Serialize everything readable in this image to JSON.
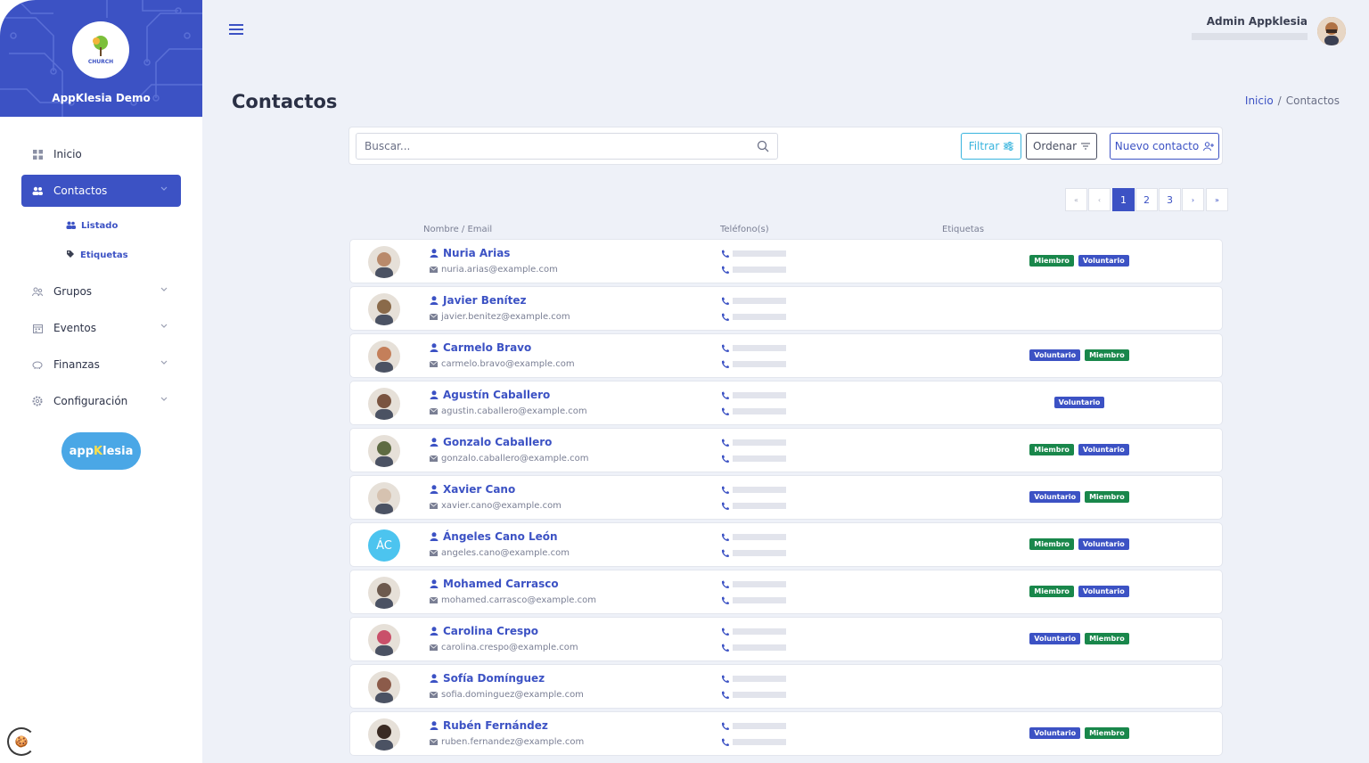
{
  "app": {
    "name": "AppKlesia Demo",
    "logo_text": "CHURCH"
  },
  "sidebar": {
    "items": [
      {
        "label": "Inicio",
        "icon": "grid-icon"
      },
      {
        "label": "Contactos",
        "icon": "users-icon",
        "active": true,
        "children": [
          {
            "label": "Listado",
            "icon": "users-icon"
          },
          {
            "label": "Etiquetas",
            "icon": "tag-icon"
          }
        ]
      },
      {
        "label": "Grupos",
        "icon": "group-icon"
      },
      {
        "label": "Eventos",
        "icon": "calendar-icon"
      },
      {
        "label": "Finanzas",
        "icon": "piggy-bank-icon"
      },
      {
        "label": "Configuración",
        "icon": "gear-icon"
      }
    ],
    "brand": {
      "prefix": "app",
      "k": "K",
      "suffix": "lesia"
    }
  },
  "header": {
    "user_name": "Admin Appklesia"
  },
  "page": {
    "title": "Contactos",
    "breadcrumb": {
      "home": "Inicio",
      "current": "Contactos"
    }
  },
  "toolbar": {
    "search_placeholder": "Buscar...",
    "filter_label": "Filtrar",
    "order_label": "Ordenar",
    "new_label": "Nuevo contacto"
  },
  "pagination": {
    "first": "«",
    "prev": "‹",
    "pages": [
      "1",
      "2",
      "3"
    ],
    "current": "1",
    "next": "›",
    "last": "»"
  },
  "table": {
    "headers": {
      "name": "Nombre / Email",
      "phone": "Teléfono(s)",
      "tags": "Etiquetas"
    },
    "rows": [
      {
        "name": "Nuria Arias",
        "email": "nuria.arias@example.com",
        "tags": [
          "Miembro",
          "Voluntario"
        ],
        "photo_color": "#b98a6b"
      },
      {
        "name": "Javier Benítez",
        "email": "javier.benitez@example.com",
        "tags": [],
        "photo_color": "#8a6a4a"
      },
      {
        "name": "Carmelo Bravo",
        "email": "carmelo.bravo@example.com",
        "tags": [
          "Voluntario",
          "Miembro"
        ],
        "photo_color": "#c47f5a"
      },
      {
        "name": "Agustín Caballero",
        "email": "agustin.caballero@example.com",
        "tags": [
          "Voluntario"
        ],
        "photo_color": "#7a5440"
      },
      {
        "name": "Gonzalo Caballero",
        "email": "gonzalo.caballero@example.com",
        "tags": [
          "Miembro",
          "Voluntario"
        ],
        "photo_color": "#5e6b42"
      },
      {
        "name": "Xavier Cano",
        "email": "xavier.cano@example.com",
        "tags": [
          "Voluntario",
          "Miembro"
        ],
        "photo_color": "#d6c2b0"
      },
      {
        "name": "Ángeles Cano León",
        "email": "angeles.cano@example.com",
        "tags": [
          "Miembro",
          "Voluntario"
        ],
        "initials": "ÁC"
      },
      {
        "name": "Mohamed Carrasco",
        "email": "mohamed.carrasco@example.com",
        "tags": [
          "Miembro",
          "Voluntario"
        ],
        "photo_color": "#6d5a4e"
      },
      {
        "name": "Carolina Crespo",
        "email": "carolina.crespo@example.com",
        "tags": [
          "Voluntario",
          "Miembro"
        ],
        "photo_color": "#c9506a"
      },
      {
        "name": "Sofía Domínguez",
        "email": "sofia.dominguez@example.com",
        "tags": [],
        "photo_color": "#8c5b4a"
      },
      {
        "name": "Rubén Fernández",
        "email": "ruben.fernandez@example.com",
        "tags": [
          "Voluntario",
          "Miembro"
        ],
        "photo_color": "#3a2a22"
      }
    ]
  }
}
